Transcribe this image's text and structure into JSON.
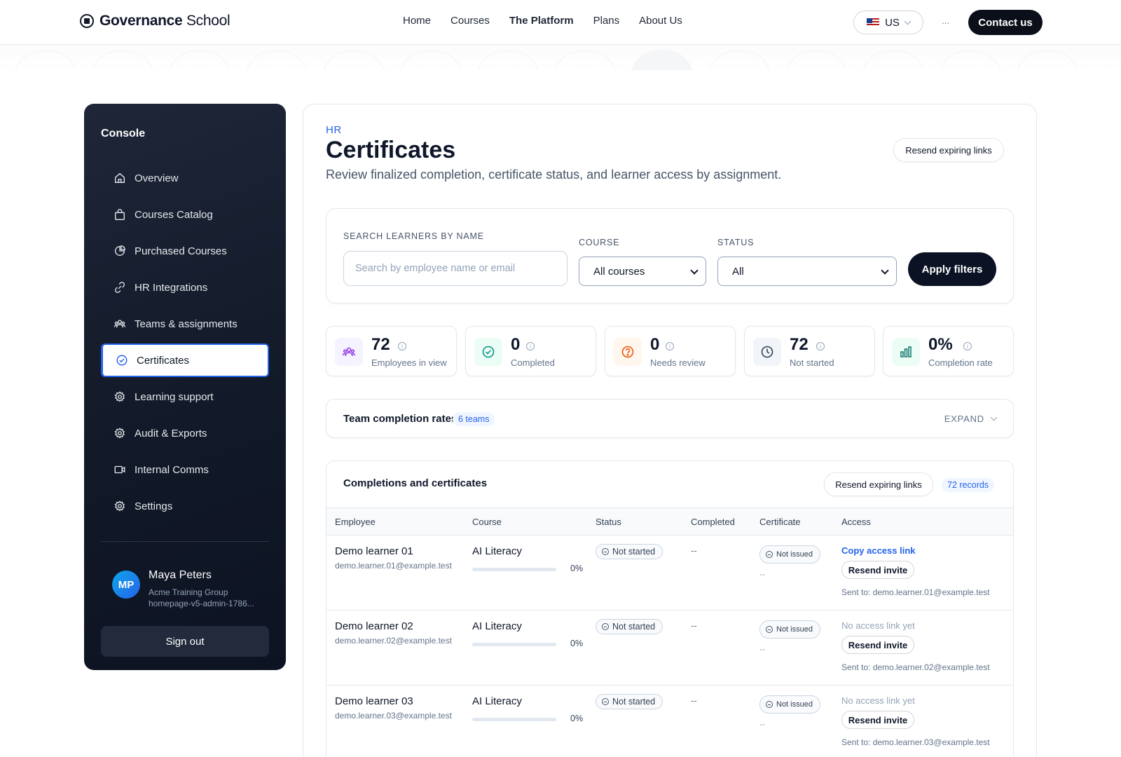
{
  "header": {
    "brand_bold": "Governance",
    "brand_rest": "School",
    "nav": [
      "Home",
      "Courses",
      "The Platform",
      "Plans",
      "About Us"
    ],
    "active_nav": "The Platform",
    "locale": "US",
    "more": "...",
    "contact": "Contact us"
  },
  "sidebar": {
    "title": "Console",
    "items": [
      {
        "label": "Overview",
        "icon": "home-icon"
      },
      {
        "label": "Courses Catalog",
        "icon": "bag-icon"
      },
      {
        "label": "Purchased Courses",
        "icon": "pie-chart-icon"
      },
      {
        "label": "HR Integrations",
        "icon": "link-icon"
      },
      {
        "label": "Teams & assignments",
        "icon": "team-icon"
      },
      {
        "label": "Certificates",
        "icon": "check-circle-icon",
        "active": true
      },
      {
        "label": "Learning support",
        "icon": "gear-icon"
      },
      {
        "label": "Audit & Exports",
        "icon": "gear-icon"
      },
      {
        "label": "Internal Comms",
        "icon": "video-icon"
      },
      {
        "label": "Settings",
        "icon": "gear-icon"
      }
    ],
    "user": {
      "initials": "MP",
      "name": "Maya Peters",
      "org": "Acme Training Group",
      "id": "homepage-v5-admin-1786..."
    },
    "sign_out": "Sign out"
  },
  "page": {
    "eyebrow": "HR",
    "title": "Certificates",
    "subtitle": "Review finalized completion, certificate status, and learner access by assignment.",
    "resend_top": "Resend expiring links"
  },
  "filters": {
    "search_label": "SEARCH LEARNERS BY NAME",
    "search_placeholder": "Search by employee name or email",
    "course_label": "COURSE",
    "course_value": "All courses",
    "status_label": "STATUS",
    "status_value": "All",
    "apply": "Apply filters"
  },
  "stats": [
    {
      "value": "72",
      "label": "Employees in view",
      "icon": "team-icon",
      "bg": "#f5f3ff",
      "color": "#9333ea"
    },
    {
      "value": "0",
      "label": "Completed",
      "icon": "check-circle-icon",
      "bg": "#ecfdf5",
      "color": "#0d9488"
    },
    {
      "value": "0",
      "label": "Needs review",
      "icon": "question-icon",
      "bg": "#fff7ed",
      "color": "#ea580c"
    },
    {
      "value": "72",
      "label": "Not started",
      "icon": "clock-icon",
      "bg": "#f1f5f9",
      "color": "#334155"
    },
    {
      "value": "0%",
      "label": "Completion rate",
      "icon": "bar-chart-icon",
      "bg": "#ecfdf5",
      "color": "#0f766e"
    }
  ],
  "teams": {
    "title": "Team completion rates",
    "badge": "6 teams",
    "expand": "EXPAND"
  },
  "table": {
    "title": "Completions and certificates",
    "resend": "Resend expiring links",
    "records": "72 records",
    "columns": [
      "Employee",
      "Course",
      "Status",
      "Completed",
      "Certificate",
      "Access"
    ],
    "rows": [
      {
        "name": "Demo learner 01",
        "email": "demo.learner.01@example.test",
        "course": "AI Literacy",
        "progress": 0,
        "pct": "0%",
        "status": "Not started",
        "completed": "--",
        "certificate": "Not issued",
        "cert_sub": "--",
        "access": "Copy access link",
        "access_live": true,
        "resend": "Resend invite",
        "sent": "Sent to: demo.learner.01@example.test"
      },
      {
        "name": "Demo learner 02",
        "email": "demo.learner.02@example.test",
        "course": "AI Literacy",
        "progress": 0,
        "pct": "0%",
        "status": "Not started",
        "completed": "--",
        "certificate": "Not issued",
        "cert_sub": "--",
        "access": "No access link yet",
        "access_live": false,
        "resend": "Resend invite",
        "sent": "Sent to: demo.learner.02@example.test"
      },
      {
        "name": "Demo learner 03",
        "email": "demo.learner.03@example.test",
        "course": "AI Literacy",
        "progress": 0,
        "pct": "0%",
        "status": "Not started",
        "completed": "--",
        "certificate": "Not issued",
        "cert_sub": "--",
        "access": "No access link yet",
        "access_live": false,
        "resend": "Resend invite",
        "sent": "Sent to: demo.learner.03@example.test"
      }
    ]
  }
}
